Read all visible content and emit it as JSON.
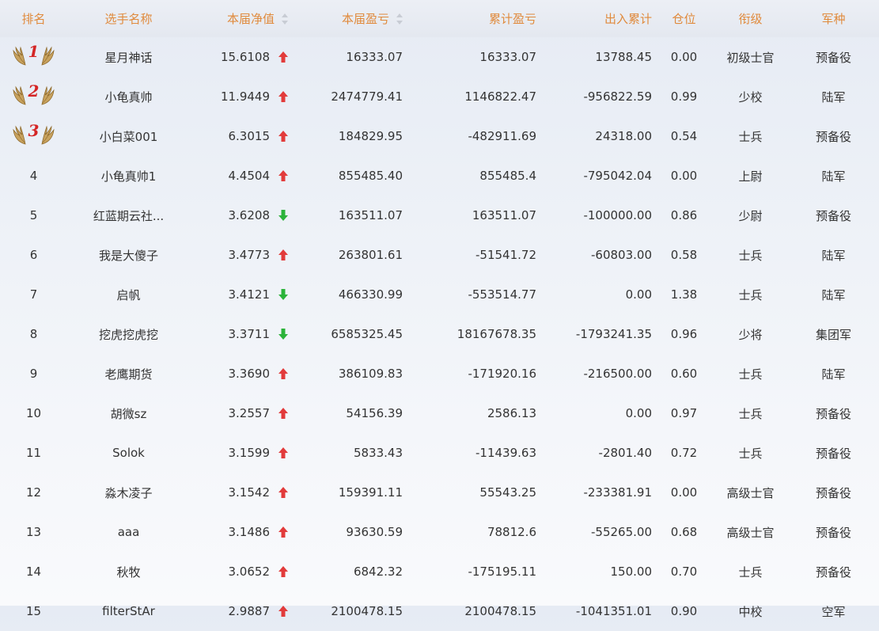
{
  "headers": {
    "rank": "排名",
    "name": "选手名称",
    "net": "本届净值",
    "pl": "本届盈亏",
    "cum_pl": "累计盈亏",
    "flow": "出入累计",
    "position": "仓位",
    "title": "衔级",
    "branch": "军种"
  },
  "colors": {
    "header_text": "#e08a3c",
    "up": "#e23b3b",
    "down": "#2bb33a",
    "medal_number": "#d42626"
  },
  "rows": [
    {
      "rank": "1",
      "medal": true,
      "name": "星月神话",
      "net": "15.6108",
      "trend": "up",
      "pl": "16333.07",
      "cum_pl": "16333.07",
      "flow": "13788.45",
      "position": "0.00",
      "title": "初级士官",
      "branch": "预备役"
    },
    {
      "rank": "2",
      "medal": true,
      "name": "小龟真帅",
      "net": "11.9449",
      "trend": "up",
      "pl": "2474779.41",
      "cum_pl": "1146822.47",
      "flow": "-956822.59",
      "position": "0.99",
      "title": "少校",
      "branch": "陆军"
    },
    {
      "rank": "3",
      "medal": true,
      "name": "小白菜001",
      "net": "6.3015",
      "trend": "up",
      "pl": "184829.95",
      "cum_pl": "-482911.69",
      "flow": "24318.00",
      "position": "0.54",
      "title": "士兵",
      "branch": "预备役"
    },
    {
      "rank": "4",
      "medal": false,
      "name": "小龟真帅1",
      "net": "4.4504",
      "trend": "up",
      "pl": "855485.40",
      "cum_pl": "855485.4",
      "flow": "-795042.04",
      "position": "0.00",
      "title": "上尉",
      "branch": "陆军"
    },
    {
      "rank": "5",
      "medal": false,
      "name": "红蓝期云社...",
      "net": "3.6208",
      "trend": "down",
      "pl": "163511.07",
      "cum_pl": "163511.07",
      "flow": "-100000.00",
      "position": "0.86",
      "title": "少尉",
      "branch": "预备役"
    },
    {
      "rank": "6",
      "medal": false,
      "name": "我是大傻子",
      "net": "3.4773",
      "trend": "up",
      "pl": "263801.61",
      "cum_pl": "-51541.72",
      "flow": "-60803.00",
      "position": "0.58",
      "title": "士兵",
      "branch": "陆军"
    },
    {
      "rank": "7",
      "medal": false,
      "name": "启帆",
      "net": "3.4121",
      "trend": "down",
      "pl": "466330.99",
      "cum_pl": "-553514.77",
      "flow": "0.00",
      "position": "1.38",
      "title": "士兵",
      "branch": "陆军"
    },
    {
      "rank": "8",
      "medal": false,
      "name": "挖虎挖虎挖",
      "net": "3.3711",
      "trend": "down",
      "pl": "6585325.45",
      "cum_pl": "18167678.35",
      "flow": "-1793241.35",
      "position": "0.96",
      "title": "少将",
      "branch": "集团军"
    },
    {
      "rank": "9",
      "medal": false,
      "name": "老鹰期货",
      "net": "3.3690",
      "trend": "up",
      "pl": "386109.83",
      "cum_pl": "-171920.16",
      "flow": "-216500.00",
      "position": "0.60",
      "title": "士兵",
      "branch": "陆军"
    },
    {
      "rank": "10",
      "medal": false,
      "name": "胡微sz",
      "net": "3.2557",
      "trend": "up",
      "pl": "54156.39",
      "cum_pl": "2586.13",
      "flow": "0.00",
      "position": "0.97",
      "title": "士兵",
      "branch": "预备役"
    },
    {
      "rank": "11",
      "medal": false,
      "name": "Solok",
      "net": "3.1599",
      "trend": "up",
      "pl": "5833.43",
      "cum_pl": "-11439.63",
      "flow": "-2801.40",
      "position": "0.72",
      "title": "士兵",
      "branch": "预备役"
    },
    {
      "rank": "12",
      "medal": false,
      "name": "淼木凌子",
      "net": "3.1542",
      "trend": "up",
      "pl": "159391.11",
      "cum_pl": "55543.25",
      "flow": "-233381.91",
      "position": "0.00",
      "title": "高级士官",
      "branch": "预备役"
    },
    {
      "rank": "13",
      "medal": false,
      "name": "aaa",
      "net": "3.1486",
      "trend": "up",
      "pl": "93630.59",
      "cum_pl": "78812.6",
      "flow": "-55265.00",
      "position": "0.68",
      "title": "高级士官",
      "branch": "预备役"
    },
    {
      "rank": "14",
      "medal": false,
      "name": "秋牧",
      "net": "3.0652",
      "trend": "up",
      "pl": "6842.32",
      "cum_pl": "-175195.11",
      "flow": "150.00",
      "position": "0.70",
      "title": "士兵",
      "branch": "预备役"
    },
    {
      "rank": "15",
      "medal": false,
      "name": "filterStAr",
      "net": "2.9887",
      "trend": "up",
      "pl": "2100478.15",
      "cum_pl": "2100478.15",
      "flow": "-1041351.01",
      "position": "0.90",
      "title": "中校",
      "branch": "空军"
    }
  ]
}
